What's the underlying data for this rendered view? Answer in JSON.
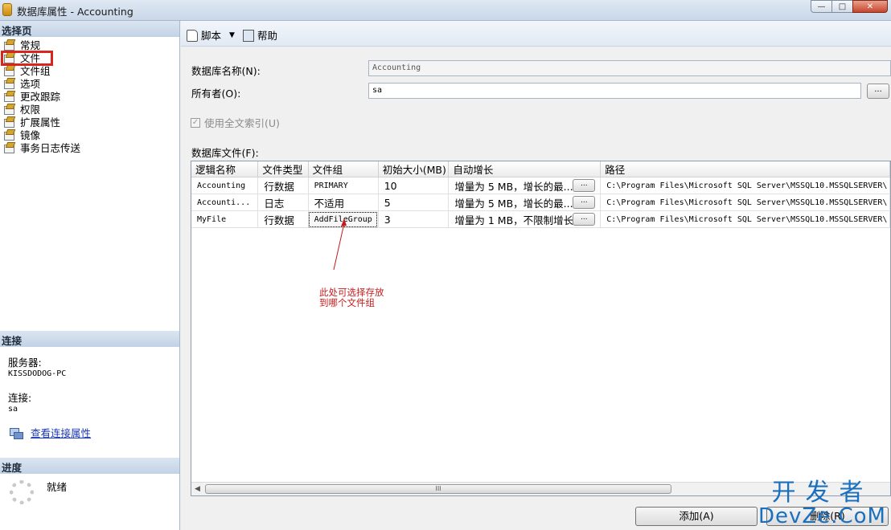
{
  "window": {
    "title": "数据库属性 - Accounting",
    "buttons": [
      "—",
      "□",
      "✕"
    ]
  },
  "left": {
    "select_page_header": "选择页",
    "pages": [
      "常规",
      "文件",
      "文件组",
      "选项",
      "更改跟踪",
      "权限",
      "扩展属性",
      "镜像",
      "事务日志传送"
    ],
    "selected_page": "文件",
    "connection_header": "连接",
    "server_label": "服务器:",
    "server_value": "KISSDODOG-PC",
    "connection_label": "连接:",
    "connection_value": "sa",
    "view_conn_link": "查看连接属性",
    "progress_header": "进度",
    "progress_status": "就绪"
  },
  "toolbar": {
    "script_label": "脚本",
    "help_label": "帮助"
  },
  "form": {
    "db_name_label": "数据库名称(N):",
    "db_name_value": "Accounting",
    "owner_label": "所有者(O):",
    "owner_value": "sa",
    "owner_button": "...",
    "fulltext_label": "使用全文索引(U)",
    "fulltext_checked": true,
    "files_label": "数据库文件(F):"
  },
  "grid": {
    "columns": [
      "逻辑名称",
      "文件类型",
      "文件组",
      "初始大小(MB)",
      "自动增长",
      "路径"
    ],
    "rows": [
      {
        "name": "Accounting",
        "type": "行数据",
        "group": "PRIMARY",
        "size": "10",
        "growth": "增量为 5 MB，增长的最...",
        "path": "C:\\Program Files\\Microsoft SQL Server\\MSSQL10.MSSQLSERVER\\"
      },
      {
        "name": "Accounti...",
        "type": "日志",
        "group": "不适用",
        "size": "5",
        "growth": "增量为 5 MB，增长的最...",
        "path": "C:\\Program Files\\Microsoft SQL Server\\MSSQL10.MSSQLSERVER\\"
      },
      {
        "name": "MyFile",
        "type": "行数据",
        "group": "AddFileGroup",
        "size": "3",
        "growth": "增量为 1 MB，不限制增长",
        "path": "C:\\Program Files\\Microsoft SQL Server\\MSSQL10.MSSQLSERVER\\"
      }
    ],
    "cell_button": "...",
    "scroll_thumb": "III"
  },
  "annotation": {
    "line1": "此处可选择存放",
    "line2": "到哪个文件组",
    "color": "#c41a1a"
  },
  "buttons": {
    "add": "添加(A)",
    "remove": "删除(R)"
  },
  "watermark": {
    "line1": "开发者",
    "line2": "DevZe.CoM"
  }
}
